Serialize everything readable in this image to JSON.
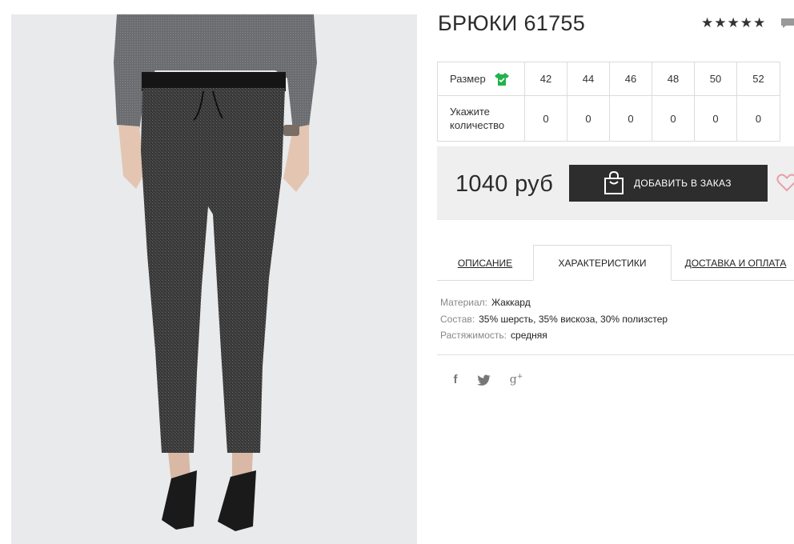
{
  "product": {
    "title": "БРЮКИ 61755",
    "rating_stars": "★★★★★",
    "rating_value": 5,
    "image_alt": "product-photo"
  },
  "sizes": {
    "row1_label": "Размер",
    "row2_label": "Укажите количество",
    "values": [
      "42",
      "44",
      "46",
      "48",
      "50",
      "52"
    ],
    "quantities": [
      "0",
      "0",
      "0",
      "0",
      "0",
      "0"
    ],
    "size_icon": "tshirt-icon",
    "size_icon_color": "#22b24c"
  },
  "buy": {
    "price": "1040 руб",
    "add_label": "ДОБАВИТЬ В ЗАКАЗ",
    "bag_icon": "shopping-bag-icon",
    "wish_icon": "heart-icon",
    "heart_color": "#e6a1a8",
    "button_color": "#2d2d2d"
  },
  "tabs": [
    {
      "label": "ОПИСАНИЕ",
      "active": false
    },
    {
      "label": "ХАРАКТЕРИСТИКИ",
      "active": true
    },
    {
      "label": "ДОСТАВКА И ОПЛАТА",
      "active": false
    }
  ],
  "specs": [
    {
      "key": "Материал:",
      "value": "Жаккард"
    },
    {
      "key": "Состав:",
      "value": "35% шерсть, 35% вискоза, 30% полизстер"
    },
    {
      "key": "Растяжимость:",
      "value": "средняя"
    }
  ],
  "social": {
    "facebook": "f",
    "twitter": "twitter-icon",
    "google_plus": "g"
  }
}
